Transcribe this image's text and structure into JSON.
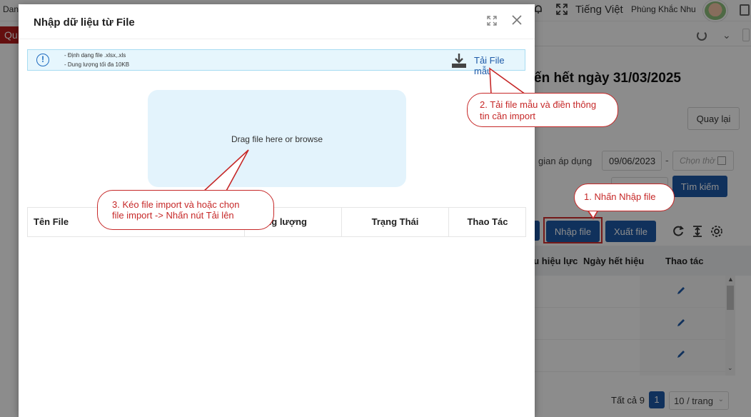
{
  "app": {
    "brand_fragment": "Dan",
    "language": "Tiếng Việt",
    "user_name": "Phùng Khắc Nhu",
    "red_tab_fragment": "Qu"
  },
  "background_page": {
    "title_fragment": "ến hết ngày 31/03/2025",
    "back_button": "Quay lại",
    "filter_label": "gian áp dụng",
    "date_from": "09/06/2023",
    "date_separator": "-",
    "date_to_placeholder": "Chọn thờ",
    "search_button": "Tìm kiếm",
    "import_button": "Nhập file",
    "export_button": "Xuất file",
    "grid_headers": [
      "ầu hiệu lực",
      "Ngày hết hiệu",
      "Thao tác"
    ],
    "pagination": {
      "total": "Tất cả 9",
      "current_page": "1",
      "page_size": "10 / trang"
    }
  },
  "modal": {
    "title": "Nhập dữ liệu từ File",
    "info_lines": [
      "- Định dạng file .xlsx,.xls",
      "- Dung lượng tối đa 10KB"
    ],
    "download_template": "Tải File mẫu",
    "dropzone_text": "Drag file here or browse",
    "table_headers": {
      "file_name": "Tên File",
      "size": "Dung lượng",
      "status": "Trạng Thái",
      "action": "Thao Tác"
    }
  },
  "callouts": {
    "step1": "1. Nhấn Nhập file",
    "step2_line1": "2. Tải file mẫu và điền thông",
    "step2_line2": "tin cần import",
    "step3_line1": "3. Kéo file import và hoặc chọn",
    "step3_line2": "file import -> Nhấn nút Tải lên"
  },
  "colors": {
    "primary": "#1e5aa8",
    "callout_red": "#c62828",
    "info_bg": "#e6f6fd",
    "dropzone_bg": "#e3f3fc"
  }
}
